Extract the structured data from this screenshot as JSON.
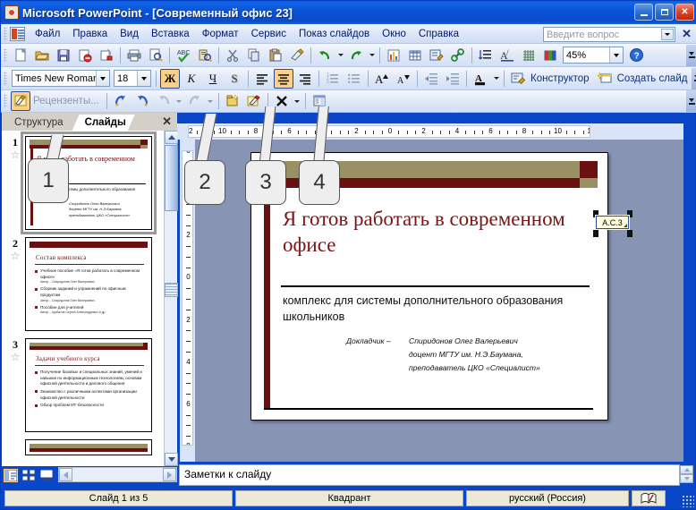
{
  "window": {
    "title": "Microsoft PowerPoint - [Современный офис 23]",
    "minimize": "_",
    "maximize": "□",
    "close": "✕"
  },
  "menu": {
    "items": [
      "Файл",
      "Правка",
      "Вид",
      "Вставка",
      "Формат",
      "Сервис",
      "Показ слайдов",
      "Окно",
      "Справка"
    ],
    "ask_placeholder": "Введите вопрос",
    "close_label": "✕"
  },
  "toolbars": {
    "standard": {
      "zoom_value": "45%",
      "icons": [
        "new-document",
        "open-folder",
        "save-floppy",
        "mail-recipient",
        "permission",
        "print",
        "print-preview",
        "spelling-check",
        "research",
        "cut-scissors",
        "copy",
        "paste",
        "format-painter",
        "undo",
        "redo",
        "insert-chart",
        "insert-table",
        "insert-diagram",
        "insert-hyperlink",
        "expand-all",
        "show-formatting",
        "show-grid",
        "color-scheme",
        "microsoft-help"
      ]
    },
    "formatting": {
      "font_name": "Times New Roman",
      "font_size": "18",
      "bold": "Ж",
      "italic": "К",
      "underline": "Ч",
      "shadow": "S",
      "designer_label": "Конструктор",
      "new_slide_label": "Создать слайд"
    },
    "reviewing": {
      "reviewers_label": "Рецензенты...",
      "icons": [
        "markup-toggle",
        "previous-item",
        "next-item",
        "apply-change",
        "unapply-change",
        "insert-comment",
        "edit-comment",
        "delete-comment",
        "reviewing-pane"
      ]
    }
  },
  "left_pane": {
    "tabs": [
      {
        "label": "Структура",
        "active": false
      },
      {
        "label": "Слайды",
        "active": true
      }
    ],
    "close_label": "✕",
    "slides": [
      {
        "number": "1",
        "selected": true,
        "title": "Я готов работать в современном офисе",
        "subtitle": "комплекс для системы дополнительного образования школьников",
        "presenter_lines": [
          "Спиридонов Олег Валерьевич",
          "доцент МГТУ им. Н.Э.Баумана,",
          "преподаватель ЦКО «Специалист»"
        ]
      },
      {
        "number": "2",
        "selected": false,
        "heading": "Состав комплекса",
        "bullets": [
          {
            "text": "Учебное пособие «Я готов работать в современном офисе»",
            "author": "Автор – Спиридонов Олег Валерьевич"
          },
          {
            "text": "Сборник заданий и упражнений по офисным продуктам",
            "author": "Автор – Спиридонов Олег Валерьевич"
          },
          {
            "text": "Пособие для учителей",
            "author": "Автор – Курбатов Сергей Александрович и др."
          }
        ]
      },
      {
        "number": "3",
        "selected": false,
        "heading": "Задачи учебного курса",
        "bullets": [
          {
            "text": "Получение базовых и специальных знаний, умений и навыков по информационным технологиям, основам офисной деятельности и делового общения",
            "author": ""
          },
          {
            "text": "Знакомство с различными аспектами организации офисной деятельности",
            "author": ""
          },
          {
            "text": "Обзор проблем ИТ-безопасности",
            "author": ""
          }
        ]
      }
    ]
  },
  "ruler": {
    "horizontal_ticks": [
      "12",
      "10",
      "8",
      "6",
      "4",
      "2",
      "0",
      "2",
      "4",
      "6",
      "8",
      "10",
      "12"
    ],
    "vertical_ticks": [
      "6",
      "4",
      "2",
      "0",
      "2",
      "4",
      "6",
      "8"
    ]
  },
  "slide": {
    "title": "Я готов работать в современном офисе",
    "subtitle": "комплекс для системы дополнительного образования школьников",
    "presenter_label": "Докладчик –",
    "presenter_lines": [
      "Спиридонов Олег Валерьевич",
      "доцент МГТУ им. Н.Э.Баумана,",
      "преподаватель ЦКО «Специалист»"
    ],
    "comment_marker": "А.С.3"
  },
  "callouts": [
    {
      "number": "1"
    },
    {
      "number": "2"
    },
    {
      "number": "3"
    },
    {
      "number": "4"
    }
  ],
  "notes": {
    "placeholder": "Заметки к слайду"
  },
  "status_bar": {
    "slide_counter": "Слайд 1 из 5",
    "design_name": "Квадрант",
    "language": "русский (Россия)",
    "spell_icon": "spell-check-icon"
  },
  "colors": {
    "title_bar_blue": "#0a4ccc",
    "slide_accent_dark_red": "#6b1010",
    "slide_accent_olive": "#9a9066",
    "slide_title_red": "#7a1515",
    "highlight_orange": "#fdd08a",
    "work_area_gray": "#8794b4"
  }
}
